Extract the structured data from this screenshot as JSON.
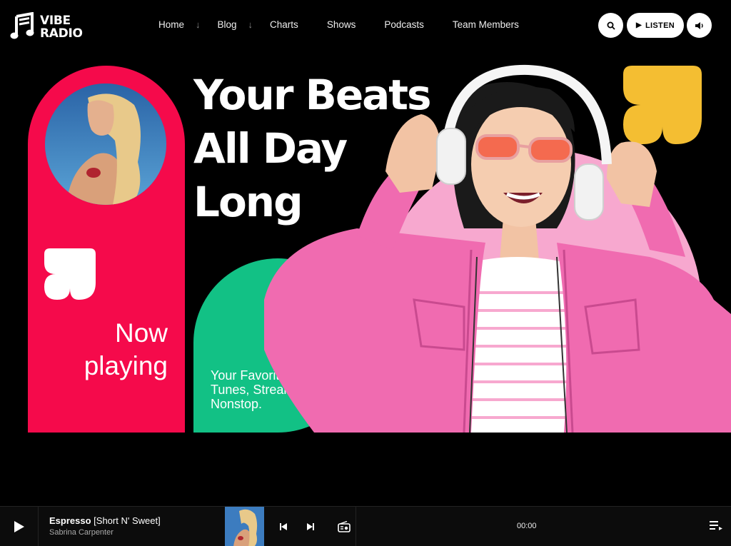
{
  "brand": {
    "line1": "VIBE",
    "line2": "RADIO",
    "logo_icon": "music-note-icon"
  },
  "nav": {
    "items": [
      {
        "label": "Home",
        "has_submenu": true
      },
      {
        "label": "Blog",
        "has_submenu": true
      },
      {
        "label": "Charts",
        "has_submenu": false
      },
      {
        "label": "Shows",
        "has_submenu": false
      },
      {
        "label": "Podcasts",
        "has_submenu": false
      },
      {
        "label": "Team Members",
        "has_submenu": false
      }
    ],
    "submenu_icon": "arrow-down-icon"
  },
  "header_actions": {
    "search_icon": "search-icon",
    "listen_label": "LISTEN",
    "listen_icon": "play-icon",
    "volume_icon": "volume-icon"
  },
  "hero": {
    "headline": [
      "Your Beats",
      "All Day",
      "Long"
    ],
    "now_playing": [
      "Now",
      "playing"
    ],
    "tagline": [
      "Your Favorite",
      "Tunes, Streaming",
      "Nonstop."
    ]
  },
  "player": {
    "track_title": "Espresso",
    "track_album": "[Short N' Sweet]",
    "artist": "Sabrina Carpenter",
    "time": "00:00",
    "icons": [
      "play-icon",
      "previous-icon",
      "next-icon",
      "radio-icon",
      "queue-icon"
    ]
  },
  "colors": {
    "background": "#000000",
    "red": "#f50a4b",
    "green": "#12c185",
    "pink": "#f7a8cf",
    "yellow": "#f4be32",
    "jacket": "#f06bb0"
  }
}
